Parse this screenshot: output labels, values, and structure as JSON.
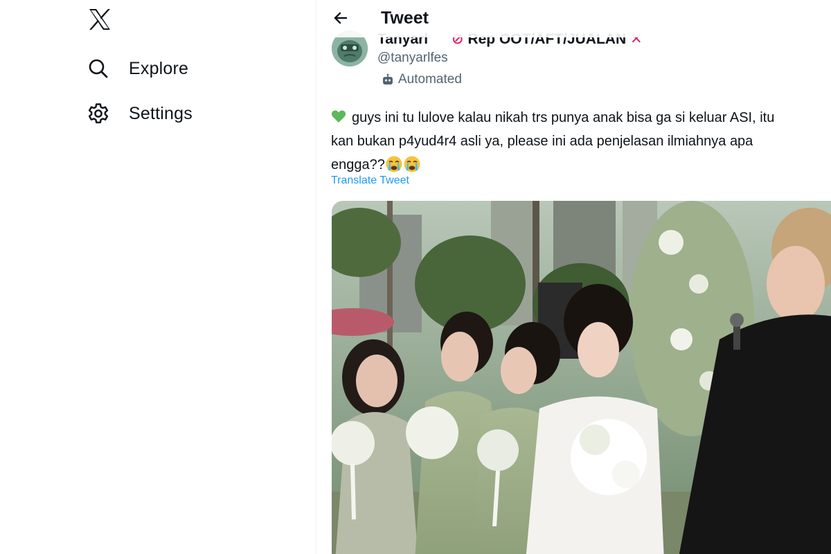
{
  "nav": {
    "logo_icon": "x-logo-icon",
    "items": [
      {
        "label": "Explore",
        "icon": "search-icon"
      },
      {
        "label": "Settings",
        "icon": "gear-icon"
      }
    ]
  },
  "header": {
    "back_icon": "arrow-left-icon",
    "title": "Tweet"
  },
  "tweet": {
    "author_name": "Tanyarl",
    "author_name_suffix": "Rep OOT/AFT/JUALAN",
    "handle": "@tanyarlfes",
    "automated_label": "Automated",
    "text_line_1": "guys ini tu lulove kalau nikah trs punya anak bisa ga si keluar ASI, itu",
    "text_line_2": "kan bukan p4yud4r4 asli ya, please ini ada penjelasan ilmiahnya apa",
    "text_line_3": "engga??",
    "translate_label": "Translate Tweet"
  },
  "colors": {
    "accent": "#1d9bf0",
    "text_primary": "#0f1419",
    "text_secondary": "#536471",
    "heart": "#5cb85c"
  }
}
